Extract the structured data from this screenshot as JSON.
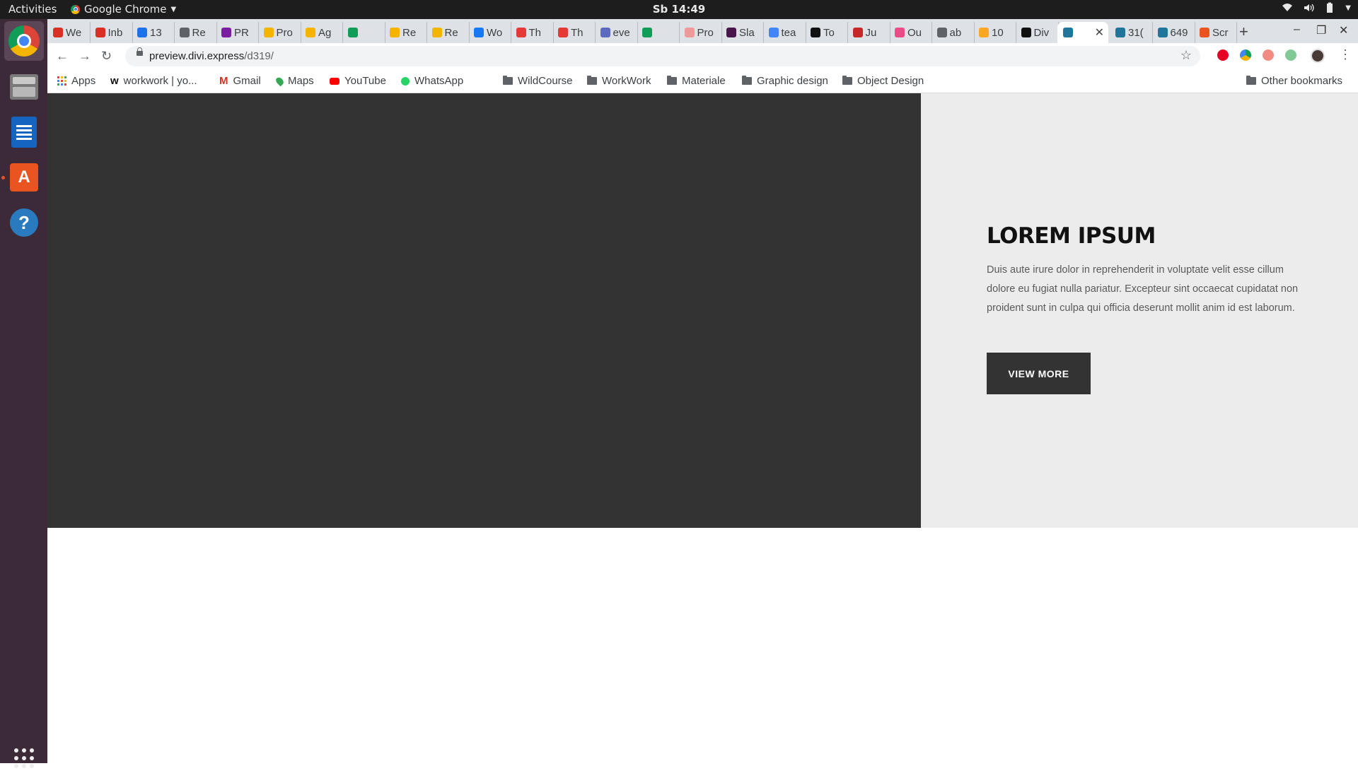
{
  "system_bar": {
    "activities": "Activities",
    "app_name": "Google Chrome",
    "clock": "Sb 14:49"
  },
  "dock": {
    "items": [
      "chrome",
      "files",
      "writer",
      "software",
      "help",
      "show-apps"
    ]
  },
  "tabs": [
    {
      "label": "We",
      "icon": "gmail",
      "color": "#d93025"
    },
    {
      "label": "Inb",
      "icon": "gmail",
      "color": "#d93025"
    },
    {
      "label": "13",
      "icon": "app",
      "color": "#1a73e8"
    },
    {
      "label": "Re",
      "icon": "app",
      "color": "#5f6368"
    },
    {
      "label": "PR",
      "icon": "app",
      "color": "#7b1fa2"
    },
    {
      "label": "Pro",
      "icon": "slides",
      "color": "#f4b400"
    },
    {
      "label": "Ag",
      "icon": "slides",
      "color": "#f4b400"
    },
    {
      "label": "",
      "icon": "maps",
      "color": "#0f9d58"
    },
    {
      "label": "Re",
      "icon": "slides",
      "color": "#f4b400"
    },
    {
      "label": "Re",
      "icon": "slides",
      "color": "#f4b400"
    },
    {
      "label": "Wo",
      "icon": "facebook",
      "color": "#1877f2"
    },
    {
      "label": "Th",
      "icon": "app",
      "color": "#e53935"
    },
    {
      "label": "Th",
      "icon": "app",
      "color": "#e53935"
    },
    {
      "label": "eve",
      "icon": "app",
      "color": "#5c6bc0"
    },
    {
      "label": "",
      "icon": "maps",
      "color": "#0f9d58"
    },
    {
      "label": "Pro",
      "icon": "app",
      "color": "#ef9a9a"
    },
    {
      "label": "Sla",
      "icon": "slack",
      "color": "#4a154b"
    },
    {
      "label": "tea",
      "icon": "google",
      "color": "#4285f4"
    },
    {
      "label": "To",
      "icon": "behance",
      "color": "#111111"
    },
    {
      "label": "Ju",
      "icon": "app",
      "color": "#c62828"
    },
    {
      "label": "Ou",
      "icon": "dribbble",
      "color": "#ea4c89"
    },
    {
      "label": "ab",
      "icon": "app",
      "color": "#5f6368"
    },
    {
      "label": "10",
      "icon": "app",
      "color": "#f9a825"
    },
    {
      "label": "Div",
      "icon": "app",
      "color": "#111111"
    },
    {
      "label": "",
      "icon": "wordpress",
      "color": "#21759b",
      "active": true
    },
    {
      "label": "31(",
      "icon": "wordpress",
      "color": "#21759b"
    },
    {
      "label": "649",
      "icon": "wordpress",
      "color": "#21759b"
    },
    {
      "label": "Scr",
      "icon": "app",
      "color": "#e95420"
    }
  ],
  "toolbar": {
    "url_host": "preview.divi.express",
    "url_path": "/d319/"
  },
  "bookmarks": {
    "items": [
      {
        "label": "Apps",
        "icon": "apps-grid-icon"
      },
      {
        "label": "workwork | yo...",
        "icon": "site-icon"
      },
      {
        "label": "Gmail",
        "icon": "gmail-icon"
      },
      {
        "label": "Maps",
        "icon": "maps-pin-icon"
      },
      {
        "label": "YouTube",
        "icon": "youtube-icon"
      },
      {
        "label": "WhatsApp",
        "icon": "whatsapp-icon"
      },
      {
        "label": "WildCourse",
        "icon": "folder-icon"
      },
      {
        "label": "WorkWork",
        "icon": "folder-icon"
      },
      {
        "label": "Materiale",
        "icon": "folder-icon"
      },
      {
        "label": "Graphic design",
        "icon": "folder-icon"
      },
      {
        "label": "Object Design",
        "icon": "folder-icon"
      }
    ],
    "other": "Other bookmarks"
  },
  "hero": {
    "title": "LOREM IPSUM",
    "body": "Duis aute irure dolor in reprehenderit in voluptate velit esse cillum dolore eu fugiat nulla pariatur. Excepteur sint occaecat cupidatat non proident sunt in culpa qui officia deserunt mollit anim id est laborum.",
    "button": "VIEW MORE",
    "dark_color": "#333333",
    "light_color": "#ececec"
  }
}
